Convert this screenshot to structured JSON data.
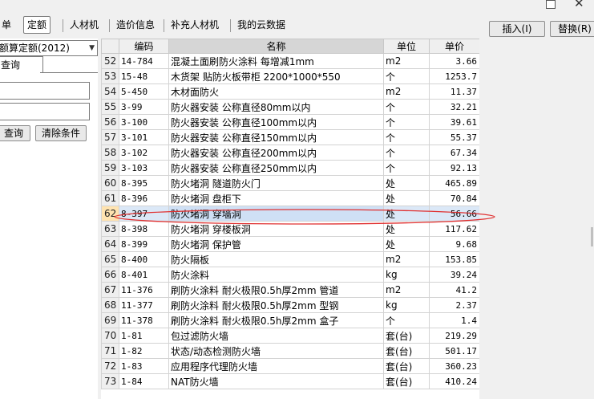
{
  "tabs": [
    {
      "label": "单",
      "active": false
    },
    {
      "label": "定额",
      "active": true
    },
    {
      "label": "人材机",
      "active": false
    },
    {
      "label": "造价信息",
      "active": false
    },
    {
      "label": "补充人材机",
      "active": false
    },
    {
      "label": "我的云数据",
      "active": false
    }
  ],
  "toolbar": {
    "insert_label": "插入(I)",
    "replace_label": "替换(R)"
  },
  "left_panel": {
    "library_select": "额算定额(2012)",
    "subtab_label": "查询",
    "input1_value": "",
    "input2_value": "",
    "query_button": "查询",
    "clear_button": "清除条件"
  },
  "table": {
    "columns": [
      "",
      "编码",
      "名称",
      "单位",
      "单价"
    ],
    "rows": [
      {
        "n": "52",
        "code": "14-784",
        "name": "混凝土面刷防火涂料 每增减1mm",
        "unit": "m2",
        "price": "3.66"
      },
      {
        "n": "53",
        "code": "15-48",
        "name": "木货架 贴防火板带柜 2200*1000*550",
        "unit": "个",
        "price": "1253.7"
      },
      {
        "n": "54",
        "code": "5-450",
        "name": "木材面防火",
        "unit": "m2",
        "price": "11.37"
      },
      {
        "n": "55",
        "code": "3-99",
        "name": "防火器安装 公称直径80mm以内",
        "unit": "个",
        "price": "32.21"
      },
      {
        "n": "56",
        "code": "3-100",
        "name": "防火器安装 公称直径100mm以内",
        "unit": "个",
        "price": "39.61"
      },
      {
        "n": "57",
        "code": "3-101",
        "name": "防火器安装 公称直径150mm以内",
        "unit": "个",
        "price": "55.37"
      },
      {
        "n": "58",
        "code": "3-102",
        "name": "防火器安装 公称直径200mm以内",
        "unit": "个",
        "price": "67.34"
      },
      {
        "n": "59",
        "code": "3-103",
        "name": "防火器安装 公称直径250mm以内",
        "unit": "个",
        "price": "92.13"
      },
      {
        "n": "60",
        "code": "8-395",
        "name": "防火堵洞 隧道防火门",
        "unit": "处",
        "price": "465.89"
      },
      {
        "n": "61",
        "code": "8-396",
        "name": "防火堵洞 盘柜下",
        "unit": "处",
        "price": "70.84"
      },
      {
        "n": "62",
        "code": "8-397",
        "name": "防火堵洞 穿墙洞",
        "unit": "处",
        "price": "56.66",
        "selected": true
      },
      {
        "n": "63",
        "code": "8-398",
        "name": "防火堵洞 穿楼板洞",
        "unit": "处",
        "price": "117.62"
      },
      {
        "n": "64",
        "code": "8-399",
        "name": "防火堵洞 保护管",
        "unit": "处",
        "price": "9.68"
      },
      {
        "n": "65",
        "code": "8-400",
        "name": "防火隔板",
        "unit": "m2",
        "price": "153.85"
      },
      {
        "n": "66",
        "code": "8-401",
        "name": "防火涂料",
        "unit": "kg",
        "price": "39.24"
      },
      {
        "n": "67",
        "code": "11-376",
        "name": "刷防火涂料 耐火极限0.5h厚2mm 管道",
        "unit": "m2",
        "price": "41.2"
      },
      {
        "n": "68",
        "code": "11-377",
        "name": "刷防火涂料 耐火极限0.5h厚2mm 型钢",
        "unit": "kg",
        "price": "2.37"
      },
      {
        "n": "69",
        "code": "11-378",
        "name": "刷防火涂料 耐火极限0.5h厚2mm 盒子",
        "unit": "个",
        "price": "1.4"
      },
      {
        "n": "70",
        "code": "1-81",
        "name": "包过滤防火墙",
        "unit": "套(台)",
        "price": "219.29"
      },
      {
        "n": "71",
        "code": "1-82",
        "name": "状态/动态检测防火墙",
        "unit": "套(台)",
        "price": "501.17"
      },
      {
        "n": "72",
        "code": "1-83",
        "name": "应用程序代理防火墙",
        "unit": "套(台)",
        "price": "360.23"
      },
      {
        "n": "73",
        "code": "1-84",
        "name": "NAT防火墙",
        "unit": "套(台)",
        "price": "410.24"
      }
    ]
  }
}
